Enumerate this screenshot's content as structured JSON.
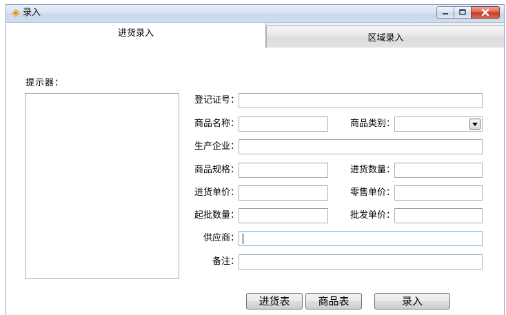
{
  "window": {
    "title": "录入",
    "icon": "app-icon",
    "controls": [
      "minimize",
      "maximize",
      "close"
    ]
  },
  "tabs": [
    {
      "label": "进货录入",
      "active": true
    },
    {
      "label": "区域录入",
      "active": false
    }
  ],
  "tip": {
    "label": "提示器：",
    "content": ""
  },
  "form": {
    "reg_no": {
      "label": "登记证号：",
      "value": ""
    },
    "product_name": {
      "label": "商品名称：",
      "value": ""
    },
    "category": {
      "label": "商品类别：",
      "value": ""
    },
    "manufacturer": {
      "label": "生产企业：",
      "value": ""
    },
    "spec": {
      "label": "商品规格：",
      "value": ""
    },
    "purchase_qty": {
      "label": "进货数量：",
      "value": ""
    },
    "purchase_price": {
      "label": "进货单价：",
      "value": ""
    },
    "retail_price": {
      "label": "零售单价：",
      "value": ""
    },
    "min_wholesale_qty": {
      "label": "起批数量：",
      "value": ""
    },
    "wholesale_price": {
      "label": "批发单价：",
      "value": ""
    },
    "supplier": {
      "label": "供应商：",
      "value": ""
    },
    "remark": {
      "label": "备注：",
      "value": ""
    }
  },
  "buttons": {
    "purchase_table": "进货表",
    "product_table": "商品表",
    "submit": "录入"
  },
  "colors": {
    "title_bar": "#d5e1f2",
    "close_button": "#c6391f",
    "focus_border": "#7eb4ea"
  }
}
